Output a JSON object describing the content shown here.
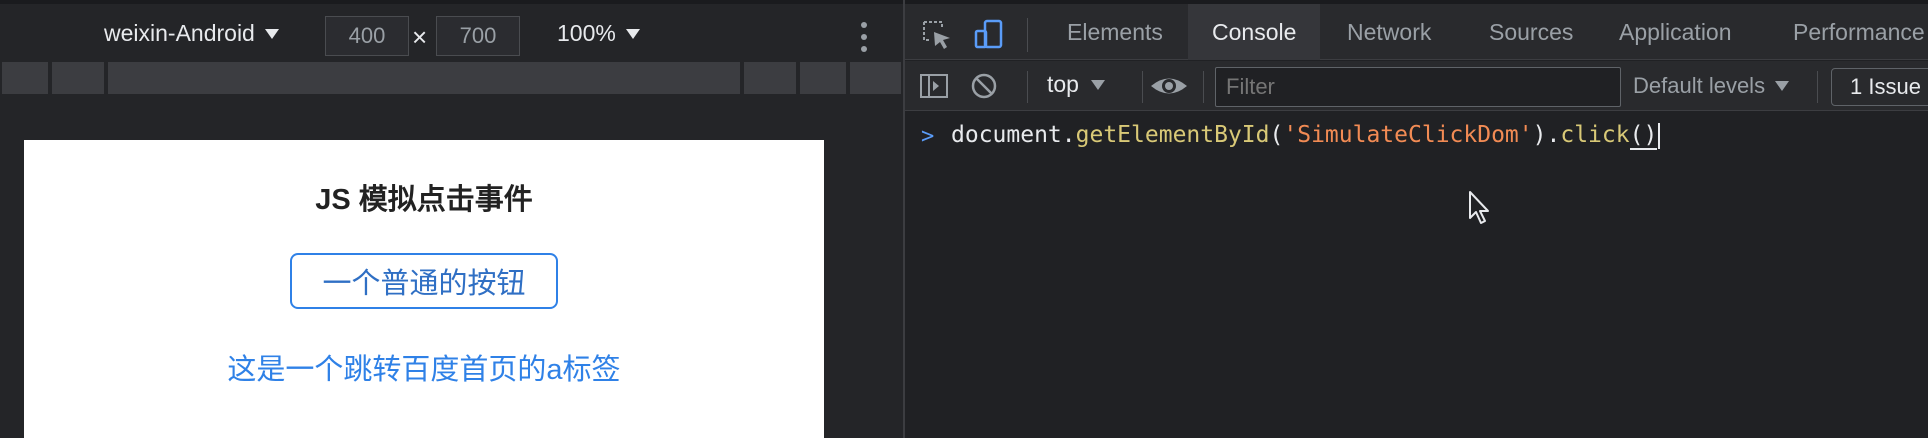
{
  "device_toolbar": {
    "device": "weixin-Android",
    "width": "400",
    "times": "×",
    "height": "700",
    "zoom": "100%"
  },
  "page": {
    "title": "JS 模拟点击事件",
    "button_label": "一个普通的按钮",
    "link_text": "这是一个跳转百度首页的a标签"
  },
  "devtools": {
    "tabs": [
      "Elements",
      "Console",
      "Network",
      "Sources",
      "Application",
      "Performance"
    ],
    "active_tab": "Console",
    "context": "top",
    "filter_placeholder": "Filter",
    "levels": "Default levels",
    "issues": "1 Issue"
  },
  "console": {
    "prompt": ">",
    "tokens": {
      "obj": "document",
      "dot1": ".",
      "method": "getElementById",
      "open1": "(",
      "arg": "'SimulateClickDom'",
      "close1": ")",
      "dot2": ".",
      "method2": "click",
      "call": "()"
    }
  },
  "colors": {
    "accent": "#2f81e7",
    "devtools_bg": "#202124",
    "string": "#f28b54",
    "function": "#d9c977"
  }
}
